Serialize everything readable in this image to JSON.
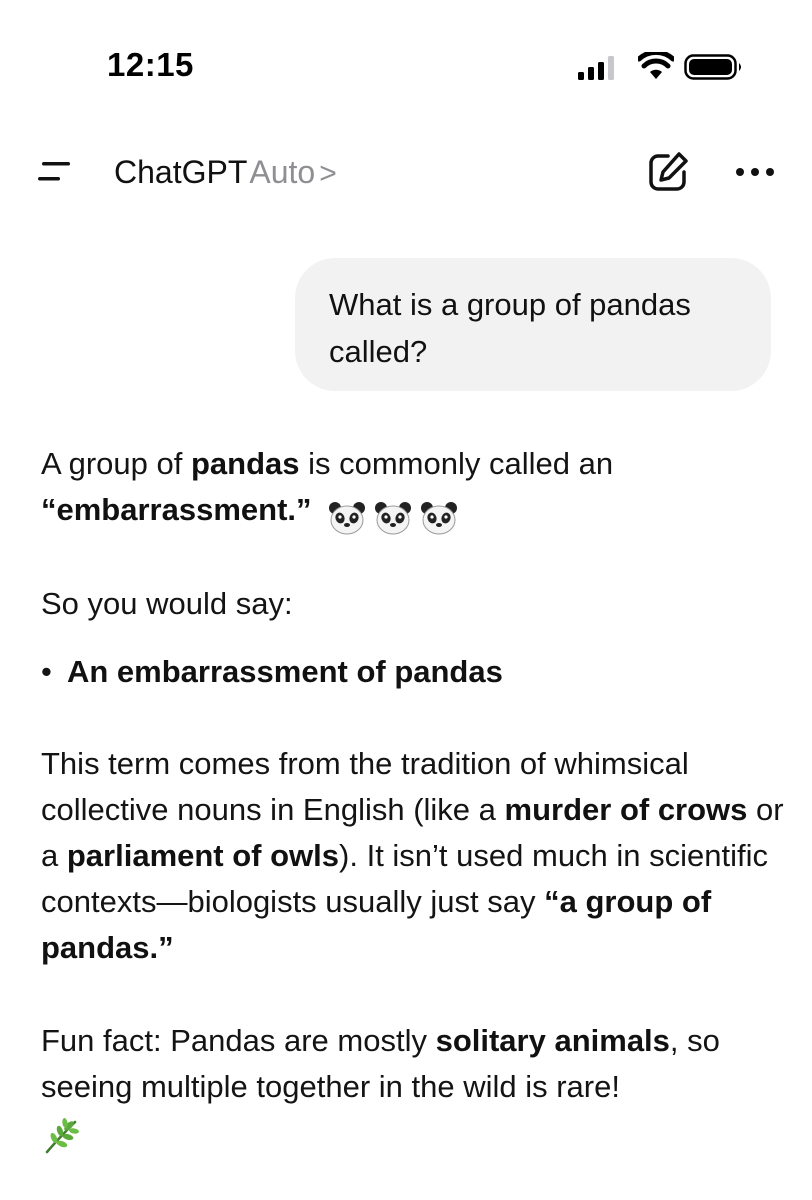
{
  "status_bar": {
    "time": "12:15",
    "signal_icon": "cellular-signal-icon",
    "wifi_icon": "wifi-icon",
    "battery_icon": "battery-icon"
  },
  "nav": {
    "menu_icon": "menu-icon",
    "brand": "ChatGPT",
    "model": "Auto",
    "chevron": ">",
    "edit_icon": "new-chat-edit-icon",
    "more_icon": "more-options-icon"
  },
  "user_message": {
    "text": "What is a group of pandas called?"
  },
  "response": {
    "p1_prefix": "A group of ",
    "p1_bold1": "pandas",
    "p1_middle": " is commonly called an ",
    "p1_bold2": "“embarrassment.”",
    "p1_emoji": "panda-face-icon",
    "p2": "So you would say:",
    "bullet_marker": "•",
    "bullet_text": "An embarrassment of pandas",
    "p3_a": "This term comes from the tradition of whimsical collective nouns in English (like a ",
    "p3_b_bold": "murder of crows",
    "p3_c": " or a ",
    "p3_d_bold": "parliament of owls",
    "p3_e": "). It isn’t used much in scientific contexts—biologists usually just say ",
    "p3_f_bold": "“a group of pandas.”",
    "p4_a": "Fun fact: Pandas are mostly ",
    "p4_b_bold": "solitary animals",
    "p4_c": ", so seeing multiple together in the wild is rare!",
    "p4_emoji": "herb-leaf-icon"
  },
  "colors": {
    "background": "#ffffff",
    "text": "#111111",
    "muted": "#8e8e93",
    "bubble": "#f2f2f2"
  }
}
